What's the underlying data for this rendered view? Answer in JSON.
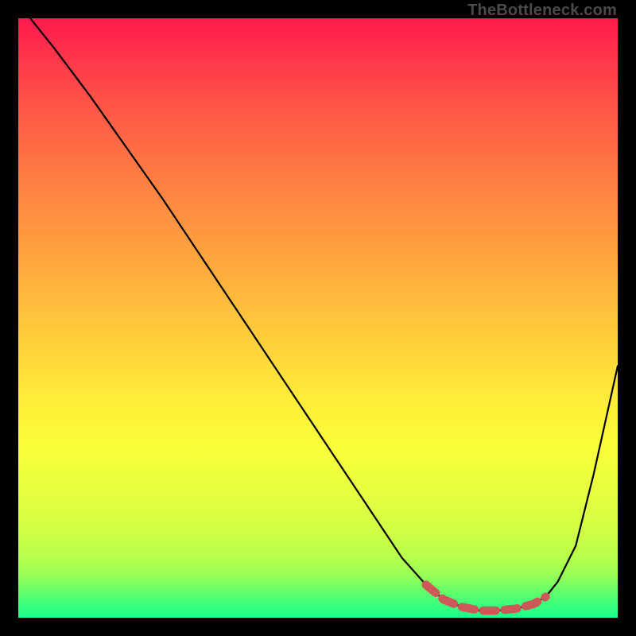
{
  "watermark": "TheBottleneck.com",
  "colors": {
    "curve": "#000000",
    "highlight": "#cf5757"
  },
  "chart_data": {
    "type": "line",
    "title": "",
    "xlabel": "",
    "ylabel": "",
    "xlim": [
      0,
      100
    ],
    "ylim": [
      0,
      100
    ],
    "grid": false,
    "legend": false,
    "series": [
      {
        "name": "bottleneck-curve",
        "x": [
          2,
          6,
          12,
          18,
          24,
          30,
          36,
          42,
          48,
          54,
          60,
          64,
          68,
          71,
          74,
          77,
          80,
          83,
          86,
          88,
          90,
          93,
          96,
          100
        ],
        "y": [
          100,
          95,
          87,
          78.5,
          70,
          61,
          52,
          43,
          34,
          25,
          16,
          10,
          5.5,
          3,
          1.8,
          1.2,
          1.2,
          1.5,
          2.3,
          3.5,
          6,
          12,
          24,
          42
        ]
      }
    ],
    "highlight": {
      "name": "optimal-range",
      "x": [
        68,
        71,
        74,
        77,
        80,
        83,
        86,
        88
      ],
      "y": [
        5.5,
        3,
        1.8,
        1.2,
        1.2,
        1.5,
        2.3,
        3.5
      ]
    }
  }
}
